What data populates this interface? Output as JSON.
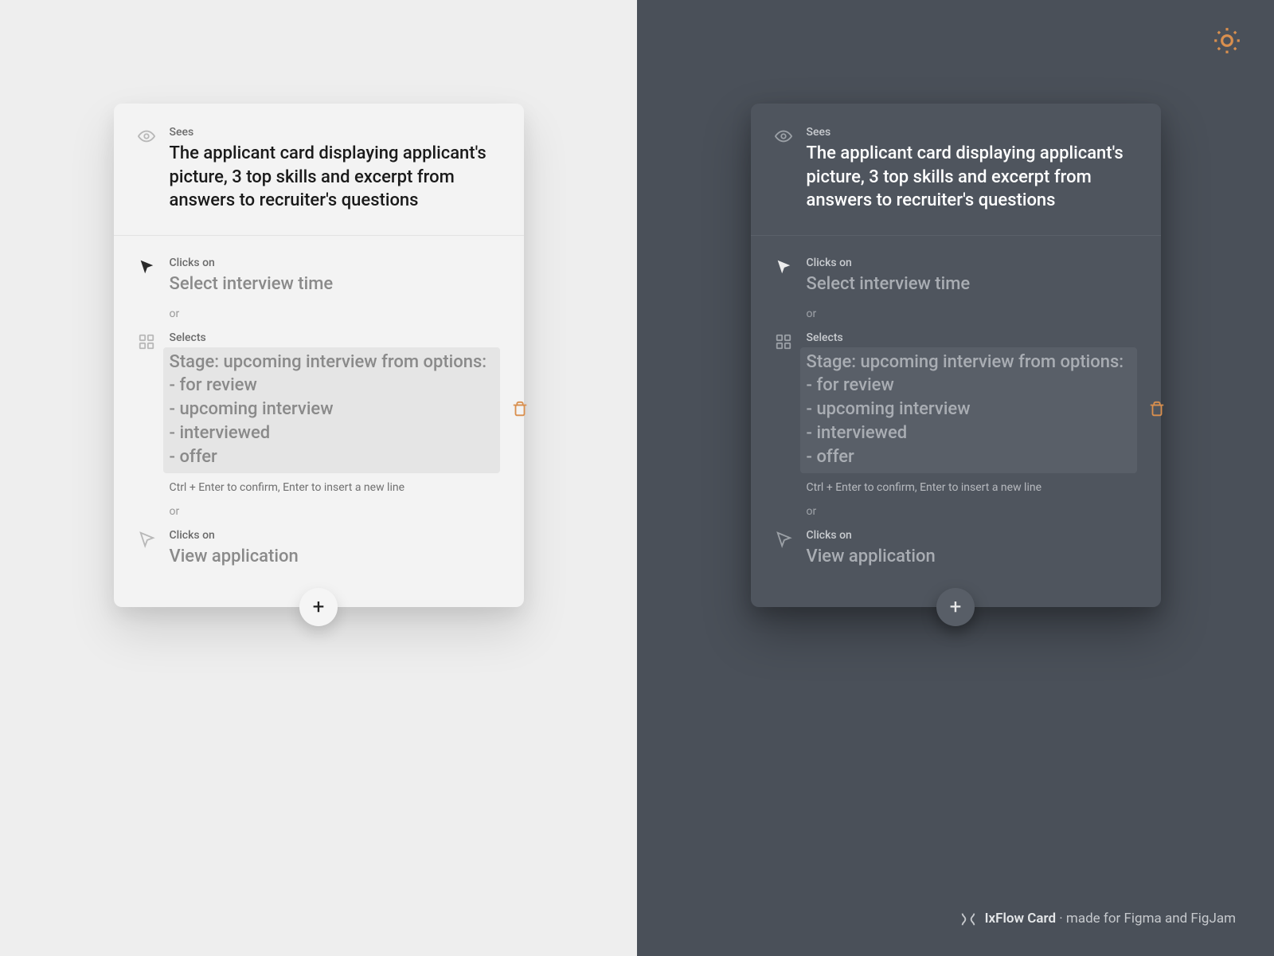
{
  "sees": {
    "label": "Sees",
    "text": "The applicant card displaying applicant's picture, 3 top skills and excerpt from answers to recruiter's questions"
  },
  "action1": {
    "label": "Clicks on",
    "text": "Select interview time"
  },
  "or": "or",
  "action2": {
    "label": "Selects",
    "text": "Stage: upcoming interview from options:\n- for review\n- upcoming interview\n- interviewed\n- offer"
  },
  "hint": "Ctrl + Enter to confirm, Enter to insert a new line",
  "action3": {
    "label": "Clicks on",
    "text": "View application"
  },
  "add": "+",
  "footer": {
    "brand": "IxFlow Card",
    "tag": " · made for Figma and FigJam"
  }
}
